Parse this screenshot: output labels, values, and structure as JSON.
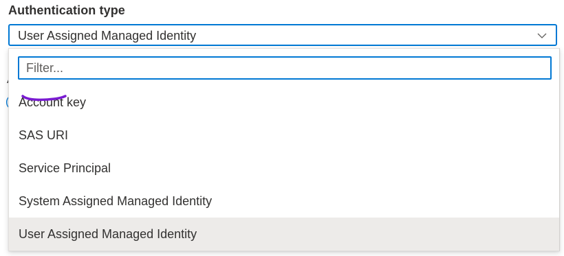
{
  "field": {
    "label": "Authentication type",
    "selected_value": "User Assigned Managed Identity",
    "chevron_icon": "chevron-down-icon"
  },
  "dropdown": {
    "filter_placeholder": "Filter...",
    "options": [
      {
        "label": "Account key"
      },
      {
        "label": "SAS URI"
      },
      {
        "label": "Service Principal"
      },
      {
        "label": "System Assigned Managed Identity"
      },
      {
        "label": "User Assigned Managed Identity",
        "selected": true
      }
    ]
  },
  "colors": {
    "focus_border": "#0078d4",
    "selected_row": "#edebe9",
    "annotation": "#7a1bd2"
  }
}
